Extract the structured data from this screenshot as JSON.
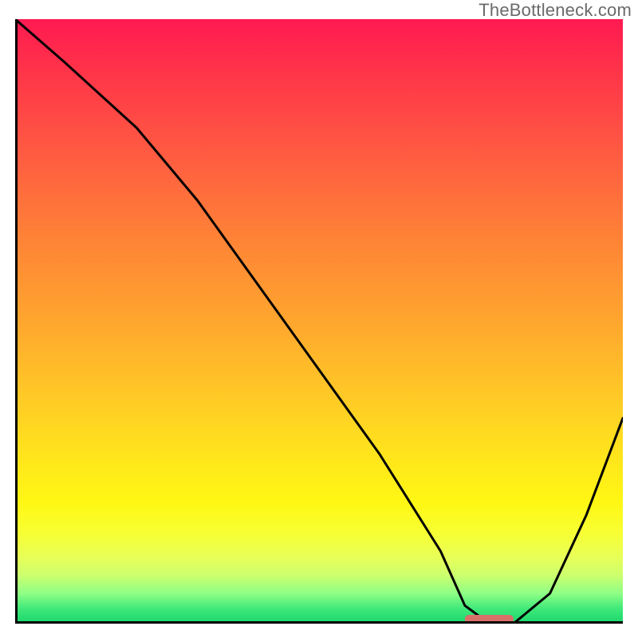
{
  "watermark": "TheBottleneck.com",
  "chart_data": {
    "type": "line",
    "title": "",
    "xlabel": "",
    "ylabel": "",
    "xlim": [
      0,
      100
    ],
    "ylim": [
      0,
      100
    ],
    "grid": false,
    "legend": false,
    "series": [
      {
        "name": "bottleneck-curve",
        "x": [
          0,
          8,
          20,
          30,
          40,
          50,
          60,
          70,
          74,
          78,
          82,
          88,
          94,
          100
        ],
        "y": [
          100,
          93,
          82,
          70,
          56,
          42,
          28,
          12,
          3,
          0,
          0,
          5,
          18,
          34
        ]
      }
    ],
    "annotations": [
      {
        "name": "highlight-segment",
        "type": "bar-marker",
        "x_start": 74,
        "x_end": 82,
        "y": 0,
        "color": "#d8706a"
      }
    ]
  }
}
